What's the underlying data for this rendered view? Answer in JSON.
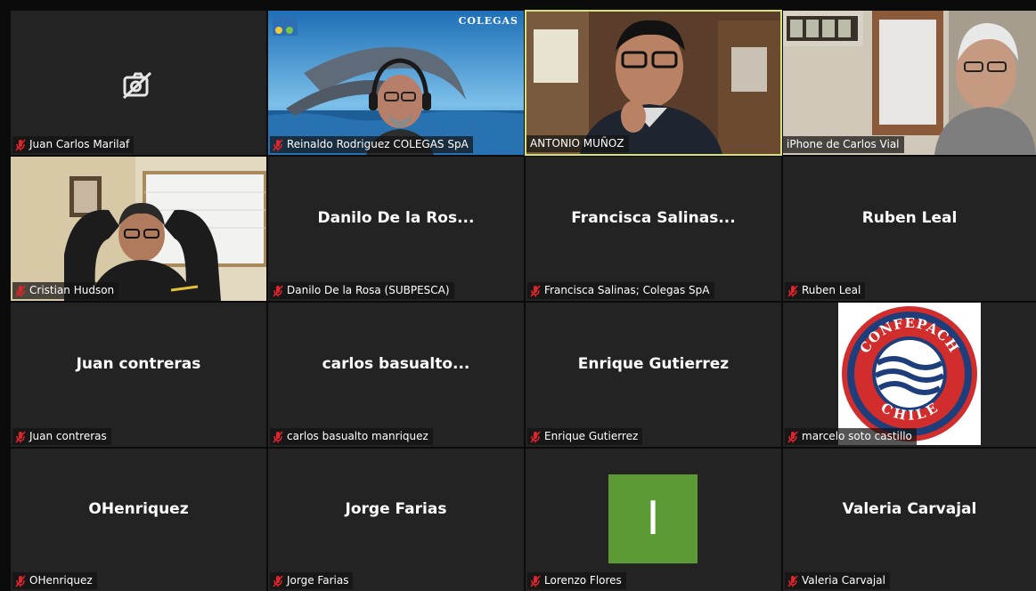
{
  "participants": [
    {
      "label": "Juan  Carlos Marilaf",
      "video_off_icon": "camera-off-icon"
    },
    {
      "label": "Reinaldo Rodriguez  COLEGAS SpA",
      "brand": "COLEGAS"
    },
    {
      "label": "ANTONIO MUÑOZ"
    },
    {
      "label": "iPhone de Carlos Vial"
    },
    {
      "label": "Cristian Hudson"
    },
    {
      "label": "Danilo De la Rosa (SUBPESCA)",
      "display": "Danilo De la Ros..."
    },
    {
      "label": "Francisca Salinas; Colegas SpA",
      "display": "Francisca  Salinas..."
    },
    {
      "label": "Ruben Leal",
      "display": "Ruben Leal"
    },
    {
      "label": "Juan contreras",
      "display": "Juan contreras"
    },
    {
      "label": "carlos basualto manriquez",
      "display": "carlos  basualto..."
    },
    {
      "label": "Enrique Gutierrez",
      "display": "Enrique Gutierrez"
    },
    {
      "label": "marcelo soto castillo",
      "logo_top": "CONFEPACH",
      "logo_bottom": "CHILE"
    },
    {
      "label": "OHenriquez",
      "display": "OHenriquez"
    },
    {
      "label": "Jorge Farias",
      "display": "Jorge Farias"
    },
    {
      "label": "Lorenzo Flores",
      "avatar_letter": "I",
      "avatar_color": "#5b9a35"
    },
    {
      "label": "Valeria Carvajal",
      "display": "Valeria Carvajal"
    }
  ],
  "colors": {
    "muted_icon": "#e0242c",
    "active_border": "#d8e07a",
    "tile_bg": "#232323"
  }
}
